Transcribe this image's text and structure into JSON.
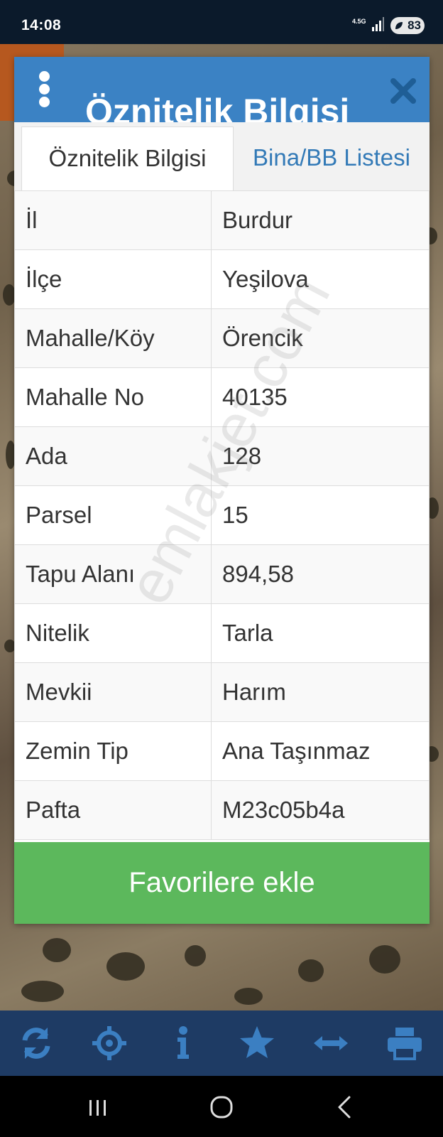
{
  "status": {
    "time": "14:08",
    "network": "4.5G",
    "battery": "83",
    "icons": [
      "network-icon",
      "signal-icon",
      "battery-icon"
    ]
  },
  "modal": {
    "title": "Öznitelik Bilgisi",
    "tabs": [
      {
        "label": "Öznitelik Bilgisi",
        "active": true
      },
      {
        "label": "Bina/BB Listesi",
        "active": false
      }
    ],
    "rows": [
      {
        "key": "İl",
        "value": "Burdur"
      },
      {
        "key": "İlçe",
        "value": "Yeşilova"
      },
      {
        "key": "Mahalle/Köy",
        "value": "Örencik"
      },
      {
        "key": "Mahalle No",
        "value": "40135"
      },
      {
        "key": "Ada",
        "value": "128"
      },
      {
        "key": "Parsel",
        "value": "15"
      },
      {
        "key": "Tapu Alanı",
        "value": "894,58"
      },
      {
        "key": "Nitelik",
        "value": "Tarla"
      },
      {
        "key": "Mevkii",
        "value": "Harım"
      },
      {
        "key": "Zemin Tip",
        "value": "Ana Taşınmaz"
      },
      {
        "key": "Pafta",
        "value": "M23c05b4a"
      }
    ],
    "favorite_label": "Favorilere ekle",
    "watermark": "emlakjet.com"
  },
  "toolbar": {
    "icons": [
      "refresh-icon",
      "locate-icon",
      "info-icon",
      "star-icon",
      "measure-icon",
      "print-icon"
    ]
  },
  "colors": {
    "header_blue": "#3b82c4",
    "link_blue": "#337ab7",
    "button_green": "#5cb85c",
    "toolbar_navy": "#1e3b64"
  }
}
